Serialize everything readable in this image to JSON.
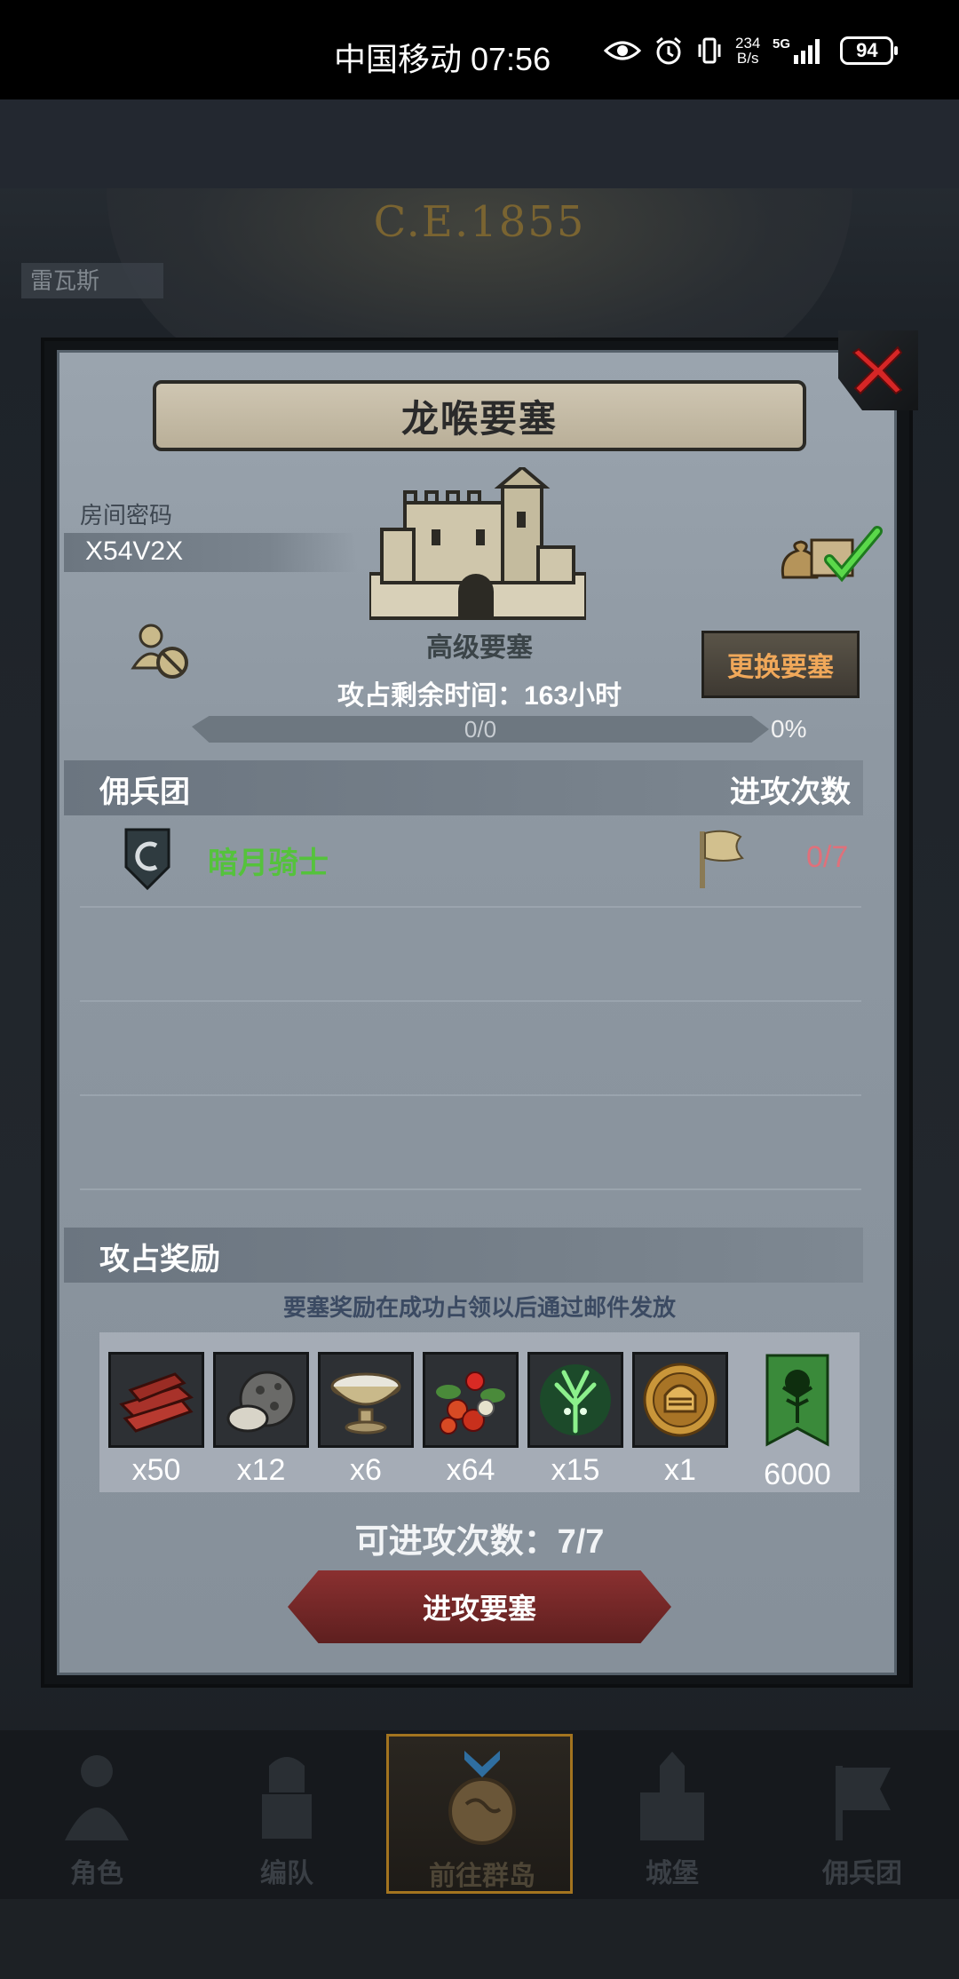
{
  "status_bar": {
    "carrier_time": "中国移动 07:56",
    "net_speed_value": "234",
    "net_speed_unit": "B/s",
    "network": "5G",
    "battery": "94"
  },
  "background": {
    "year": "C.E.1855",
    "city": "雷瓦斯"
  },
  "dialog": {
    "title": "龙喉要塞",
    "room_label": "房间密码",
    "room_code": "X54V2X",
    "fortress_grade": "高级要塞",
    "change_button": "更换要塞",
    "time_remaining": "攻占剩余时间：163小时",
    "progress_text": "0/0",
    "progress_percent": "0%",
    "progress_fraction": 0,
    "mercenary_header": "佣兵团",
    "attack_count_header": "进攻次数",
    "mercenaries": [
      {
        "name": "暗月骑士",
        "attacks": "0/7"
      }
    ],
    "rewards_header": "攻占奖励",
    "rewards_notice": "要塞奖励在成功占领以后通过邮件发放",
    "rewards": [
      {
        "icon": "wood-icon",
        "qty": "x50"
      },
      {
        "icon": "truffle-icon",
        "qty": "x12"
      },
      {
        "icon": "milk-bowl-icon",
        "qty": "x6"
      },
      {
        "icon": "berries-icon",
        "qty": "x64"
      },
      {
        "icon": "green-tree-spirit-icon",
        "qty": "x15"
      },
      {
        "icon": "knight-helmet-coin-icon",
        "qty": "x1"
      },
      {
        "icon": "guild-banner-icon",
        "qty": "6000"
      }
    ],
    "available_attacks": "可进攻次数：7/7",
    "attack_button": "进攻要塞"
  },
  "bottom_nav": [
    {
      "label": "角色",
      "icon": "character-icon"
    },
    {
      "label": "编队",
      "icon": "formation-icon"
    },
    {
      "label": "前往群岛",
      "icon": "islands-icon"
    },
    {
      "label": "城堡",
      "icon": "castle-icon"
    },
    {
      "label": "佣兵团",
      "icon": "mercenary-icon"
    }
  ],
  "colors": {
    "merc_name": "#55c23c",
    "attack_count_text": "#e0707a",
    "change_button_text": "#f0a85a",
    "attack_button": "#7a2a2a"
  }
}
